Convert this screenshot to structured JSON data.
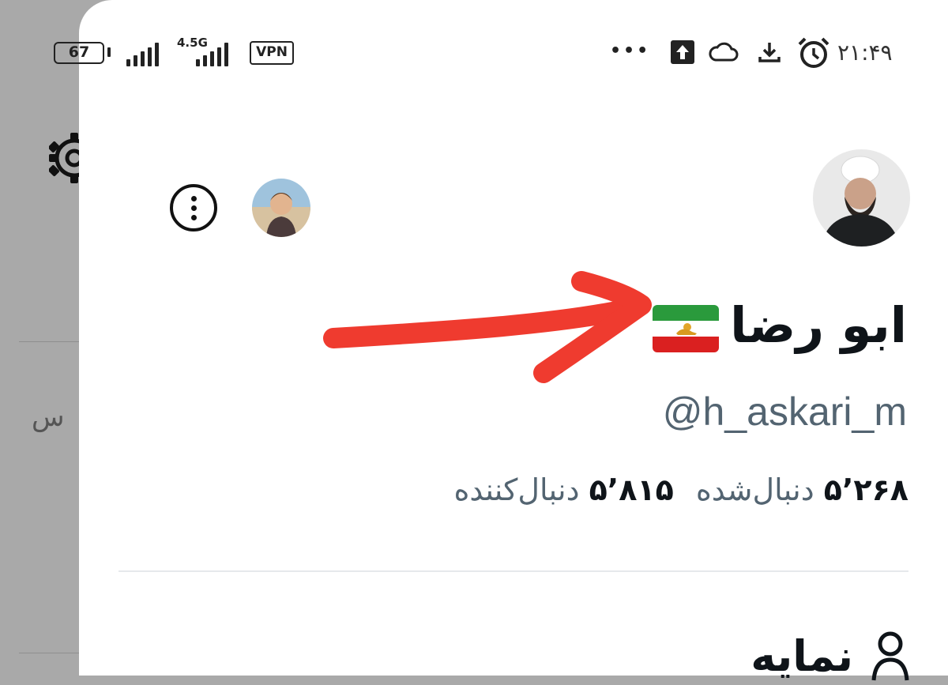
{
  "status_bar": {
    "battery": "67",
    "network": "4.5G",
    "vpn": "VPN",
    "more": "•••",
    "time": "۲۱:۴۹"
  },
  "background_page": {
    "partial_text": "س"
  },
  "profile": {
    "display_name": "ابو رضا",
    "handle": "@h_askari_m",
    "following_count": "۵٬۲۶۸",
    "following_label": "دنبال‌شده",
    "followers_count": "۵٬۸۱۵",
    "followers_label": "دنبال‌کننده"
  },
  "menu": {
    "profile_label": "نمایه"
  },
  "colors": {
    "annotation_arrow": "#ef3b2f",
    "text_primary": "#0f1419",
    "text_secondary": "#536471"
  }
}
